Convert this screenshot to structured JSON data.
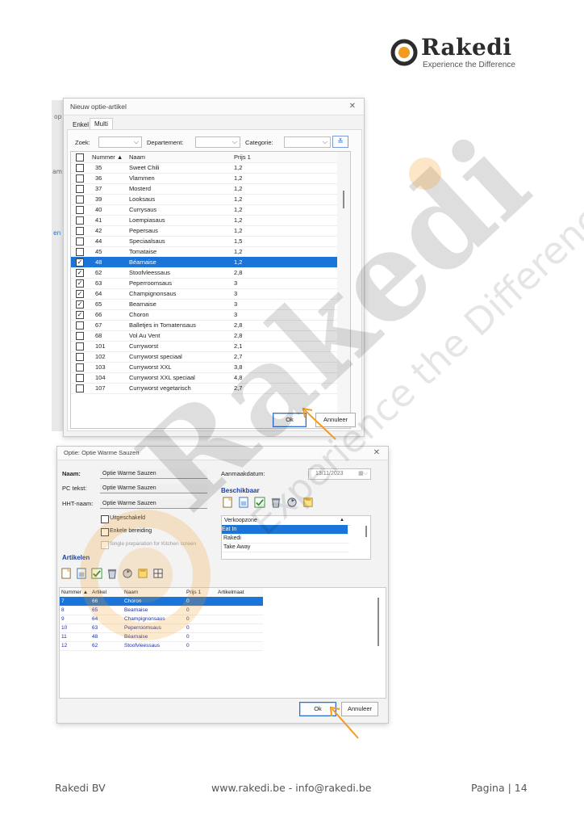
{
  "logo": {
    "word": "Rakedi",
    "tagline": "Experience the Difference"
  },
  "watermark": {
    "word": "Rakedi",
    "tagline": "Experience the Difference"
  },
  "dialog1": {
    "title": "Nieuw optie-artikel",
    "tabs": [
      "Enkel",
      "Multi"
    ],
    "filters": {
      "search_label": "Zoek:",
      "department_label": "Departement:",
      "category_label": "Categorie:"
    },
    "columns": [
      "Nummer",
      "Naam",
      "Prijs 1"
    ],
    "rows": [
      {
        "checked": false,
        "nummer": "35",
        "naam": "Sweet Chili",
        "prijs": "1,2"
      },
      {
        "checked": false,
        "nummer": "36",
        "naam": "Vlammen",
        "prijs": "1,2"
      },
      {
        "checked": false,
        "nummer": "37",
        "naam": "Mosterd",
        "prijs": "1,2"
      },
      {
        "checked": false,
        "nummer": "39",
        "naam": "Looksaus",
        "prijs": "1,2"
      },
      {
        "checked": false,
        "nummer": "40",
        "naam": "Currysaus",
        "prijs": "1,2"
      },
      {
        "checked": false,
        "nummer": "41",
        "naam": "Loempiasaus",
        "prijs": "1,2"
      },
      {
        "checked": false,
        "nummer": "42",
        "naam": "Pepersaus",
        "prijs": "1,2"
      },
      {
        "checked": false,
        "nummer": "44",
        "naam": "Speciaalsaus",
        "prijs": "1,5"
      },
      {
        "checked": false,
        "nummer": "45",
        "naam": "Tomataise",
        "prijs": "1,2"
      },
      {
        "checked": true,
        "nummer": "48",
        "naam": "Béarnaise",
        "prijs": "1,2",
        "selected": true
      },
      {
        "checked": true,
        "nummer": "62",
        "naam": "Stoofvleessaus",
        "prijs": "2,8"
      },
      {
        "checked": true,
        "nummer": "63",
        "naam": "Peperroomsaus",
        "prijs": "3"
      },
      {
        "checked": true,
        "nummer": "64",
        "naam": "Champignonsaus",
        "prijs": "3"
      },
      {
        "checked": true,
        "nummer": "65",
        "naam": "Bearnaise",
        "prijs": "3"
      },
      {
        "checked": true,
        "nummer": "66",
        "naam": "Choron",
        "prijs": "3"
      },
      {
        "checked": false,
        "nummer": "67",
        "naam": "Balletjes in Tomatensaus",
        "prijs": "2,8"
      },
      {
        "checked": false,
        "nummer": "68",
        "naam": "Vol Au Vent",
        "prijs": "2,8"
      },
      {
        "checked": false,
        "nummer": "101",
        "naam": "Curryworst",
        "prijs": "2,1"
      },
      {
        "checked": false,
        "nummer": "102",
        "naam": "Curryworst speciaal",
        "prijs": "2,7"
      },
      {
        "checked": false,
        "nummer": "103",
        "naam": "Curryworst XXL",
        "prijs": "3,8"
      },
      {
        "checked": false,
        "nummer": "104",
        "naam": "Curryworst XXL speciaal",
        "prijs": "4,8"
      },
      {
        "checked": false,
        "nummer": "107",
        "naam": "Curryworst vegetarisch",
        "prijs": "2,7"
      }
    ],
    "ok_label": "Ok",
    "cancel_label": "Annuleer",
    "behind_fragments": [
      "op",
      "am:",
      "en"
    ]
  },
  "dialog2": {
    "title": "Optie: Optie Warme Sauzen",
    "naam_label": "Naam:",
    "naam_value": "Optie Warme Sauzen",
    "pc_label": "PC tekst:",
    "pc_value": "Optie Warme Sauzen",
    "hht_label": "HHT-naam:",
    "hht_value": "Optie Warme Sauzen",
    "date_label": "Aanmaakdatum:",
    "date_value": "13/11/2023",
    "beschikbaar_label": "Beschikbaar",
    "checks": [
      {
        "label": "Uitgeschakeld",
        "checked": false,
        "disabled": false
      },
      {
        "label": "Enkele bereiding",
        "checked": false,
        "disabled": false
      },
      {
        "label": "Single preparation for Kitchen screen",
        "checked": false,
        "disabled": true
      }
    ],
    "zones_header": "Verkoopzone",
    "zones": [
      "Eat In",
      "Rakedi",
      "Take Away"
    ],
    "artikelen_label": "Artikelen",
    "columns": [
      "Nummer",
      "Artikel",
      "Naam",
      "Prijs 1",
      "Artikelmaat"
    ],
    "rows": [
      {
        "nummer": "7",
        "artikel": "66",
        "naam": "Choron",
        "prijs": "0",
        "selected": true
      },
      {
        "nummer": "8",
        "artikel": "65",
        "naam": "Bearnaise",
        "prijs": "0"
      },
      {
        "nummer": "9",
        "artikel": "64",
        "naam": "Champignonsaus",
        "prijs": "0"
      },
      {
        "nummer": "10",
        "artikel": "63",
        "naam": "Peperroomsaus",
        "prijs": "0"
      },
      {
        "nummer": "11",
        "artikel": "48",
        "naam": "Béarnaise",
        "prijs": "0"
      },
      {
        "nummer": "12",
        "artikel": "62",
        "naam": "Stoofvleessaus",
        "prijs": "0"
      }
    ],
    "ok_label": "Ok",
    "cancel_label": "Annuleer"
  },
  "footer": {
    "company": "Rakedi BV",
    "contact": "www.rakedi.be - info@rakedi.be",
    "page": "Pagina | 14"
  },
  "colors": {
    "accent": "#f29b21",
    "selection": "#1b74d8",
    "brand_dark": "#2c2c2c"
  }
}
